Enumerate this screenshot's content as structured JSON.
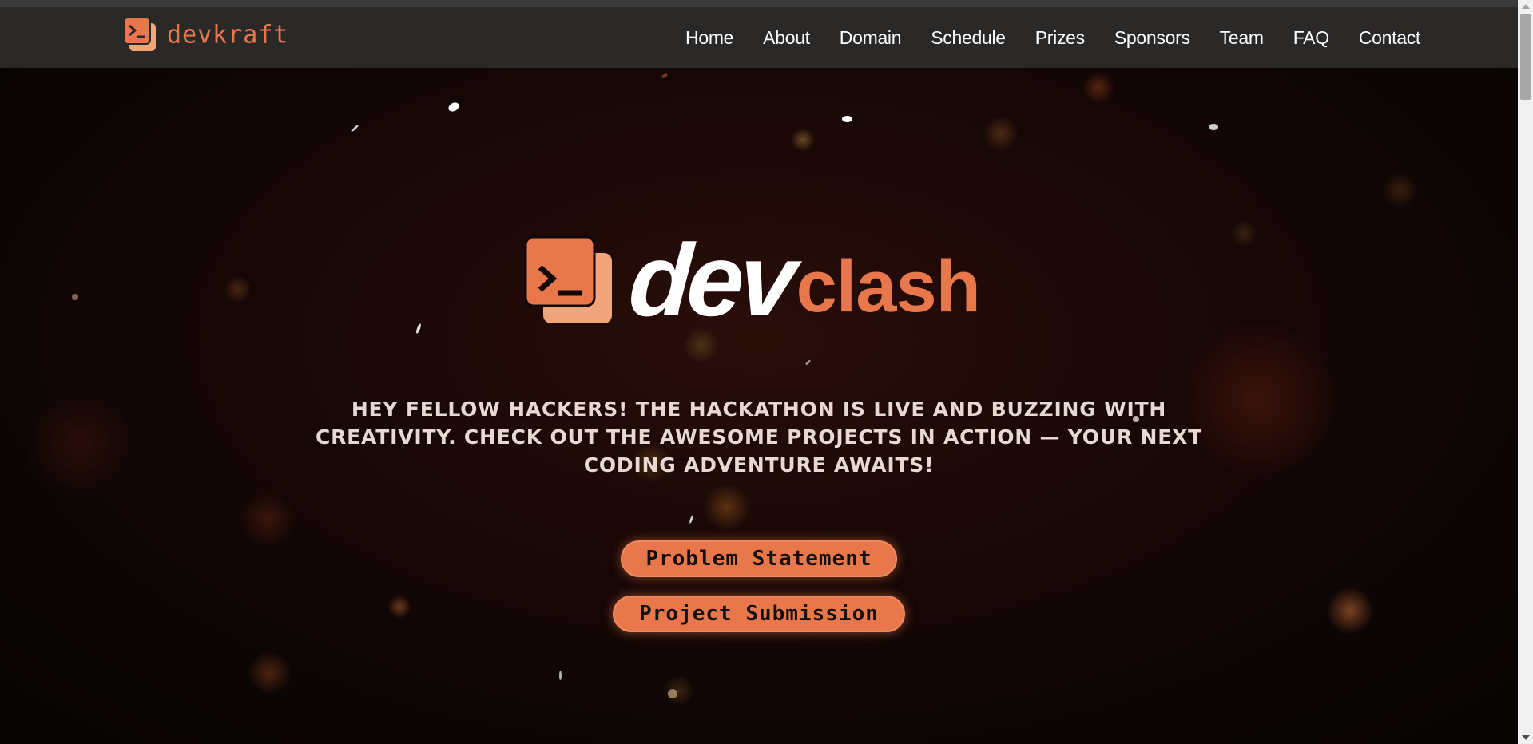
{
  "nav": {
    "logo_text": "devkraft",
    "links": [
      "Home",
      "About",
      "Domain",
      "Schedule",
      "Prizes",
      "Sponsors",
      "Team",
      "FAQ",
      "Contact"
    ]
  },
  "hero": {
    "logo_dev": "dev",
    "logo_clash": "clash",
    "tagline": "HEY FELLOW HACKERS! THE HACKATHON IS LIVE AND BUZZING WITH CREATIVITY. CHECK OUT THE AWESOME PROJECTS IN ACTION — YOUR NEXT CODING ADVENTURE AWAITS!",
    "buttons": {
      "problem_statement": "Problem Statement",
      "project_submission": "Project Submission"
    }
  },
  "colors": {
    "accent": "#e8784c",
    "navbar_bg": "#2b2828",
    "hero_bg": "#0c0707"
  },
  "icons": {
    "logo_icon": "terminal-window-icon"
  }
}
